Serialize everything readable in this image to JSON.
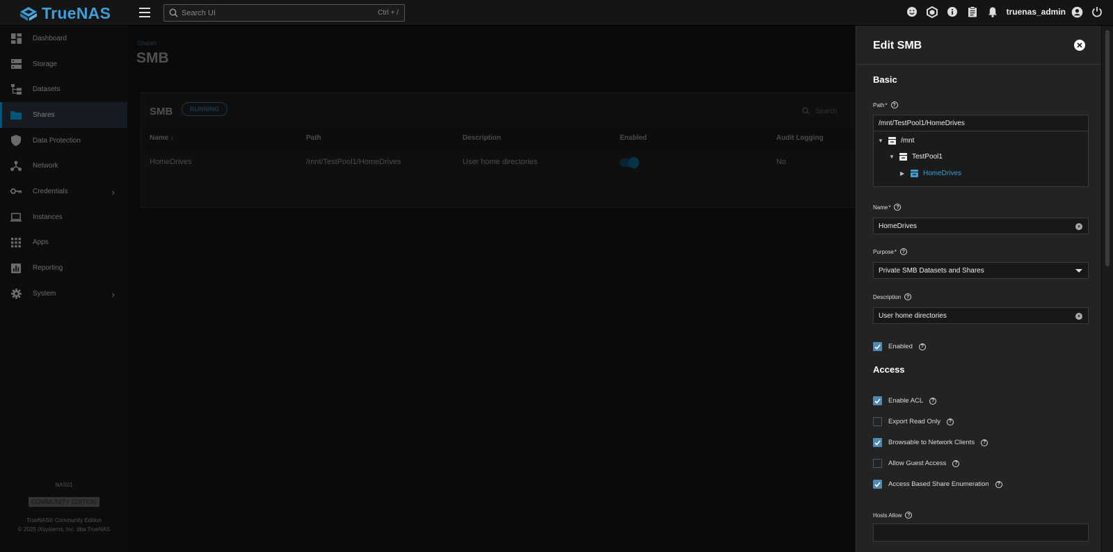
{
  "app": {
    "logo_text": "TrueNAS"
  },
  "search": {
    "placeholder": "Search UI",
    "shortcut": "Ctrl + /"
  },
  "user": {
    "name": "truenas_admin"
  },
  "sidebar": {
    "items": [
      {
        "label": "Dashboard",
        "icon": "dashboard-icon"
      },
      {
        "label": "Storage",
        "icon": "storage-icon"
      },
      {
        "label": "Datasets",
        "icon": "datasets-icon"
      },
      {
        "label": "Shares",
        "icon": "shares-icon",
        "active": true
      },
      {
        "label": "Data Protection",
        "icon": "shield-icon"
      },
      {
        "label": "Network",
        "icon": "network-icon"
      },
      {
        "label": "Credentials",
        "icon": "key-icon",
        "expandable": true
      },
      {
        "label": "Instances",
        "icon": "laptop-icon"
      },
      {
        "label": "Apps",
        "icon": "apps-grid-icon"
      },
      {
        "label": "Reporting",
        "icon": "reporting-icon"
      },
      {
        "label": "System",
        "icon": "gear-icon",
        "expandable": true
      }
    ],
    "hostname": "NAS01",
    "edition_badge": "COMMUNITY EDITION",
    "edition_text": "TrueNAS® Community Edition",
    "copyright": "© 2025 iXsystems, Inc. dba TrueNAS"
  },
  "main": {
    "breadcrumb": "Shares",
    "title": "SMB",
    "card": {
      "title": "SMB",
      "status": "RUNNING",
      "search_placeholder": "Search",
      "columns": [
        "Name ↓",
        "Path",
        "Description",
        "Enabled",
        "Audit Logging"
      ],
      "rows": [
        {
          "name": "HomeDrives",
          "path": "/mnt/TestPool1/HomeDrives",
          "description": "User home directories",
          "enabled": true,
          "audit": "No"
        }
      ]
    }
  },
  "panel": {
    "title": "Edit SMB",
    "basic_section": "Basic",
    "path_label": "Path",
    "path_value": "/mnt/TestPool1/HomeDrives",
    "tree": [
      {
        "label": "/mnt",
        "level": 0
      },
      {
        "label": "TestPool1",
        "level": 1
      },
      {
        "label": "HomeDrives",
        "level": 2,
        "selected": true
      }
    ],
    "name_label": "Name",
    "name_value": "HomeDrives",
    "purpose_label": "Purpose",
    "purpose_value": "Private SMB Datasets and Shares",
    "description_label": "Description",
    "description_value": "User home directories",
    "enabled_label": "Enabled",
    "enabled_checked": true,
    "access_section": "Access",
    "access_options": [
      {
        "label": "Enable ACL",
        "checked": true
      },
      {
        "label": "Export Read Only",
        "checked": false
      },
      {
        "label": "Browsable to Network Clients",
        "checked": true
      },
      {
        "label": "Allow Guest Access",
        "checked": false
      },
      {
        "label": "Access Based Share Enumeration",
        "checked": true
      }
    ],
    "hosts_allow_label": "Hosts Allow",
    "hosts_allow_value": ""
  },
  "colors": {
    "accent": "#0095d5",
    "brand": "#3f9ed8",
    "panel_bg": "#232323"
  }
}
